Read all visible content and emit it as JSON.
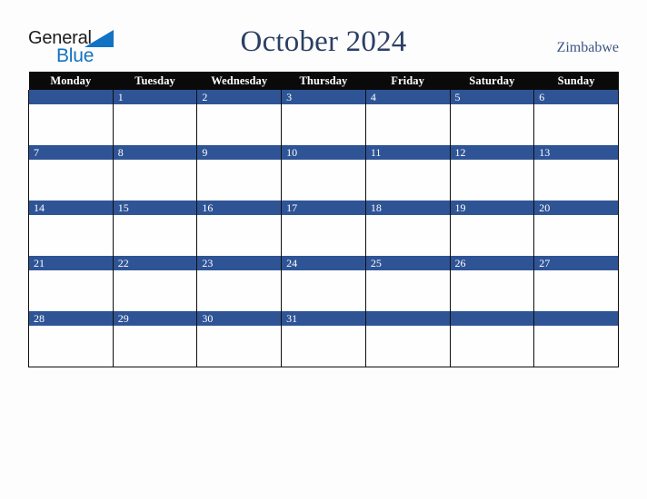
{
  "brand": {
    "word1": "General",
    "word2": "Blue",
    "triangle_icon": "triangle-icon",
    "word1_color": "#1c1c1c",
    "word2_color": "#1272c4",
    "triangle_color": "#1272c4"
  },
  "header": {
    "title": "October 2024",
    "country": "Zimbabwe",
    "title_color": "#2b3f64",
    "country_color": "#3c5580"
  },
  "calendar": {
    "weekday_headers": [
      "Monday",
      "Tuesday",
      "Wednesday",
      "Thursday",
      "Friday",
      "Saturday",
      "Sunday"
    ],
    "header_bg": "#0a0a0a",
    "header_text_color": "#ffffff",
    "daynum_bar_color": "#2f5496",
    "daynum_text_color": "#ffffff",
    "cell_bg": "#fefefe",
    "border_color": "#0e0e0e",
    "weeks": [
      [
        "",
        "1",
        "2",
        "3",
        "4",
        "5",
        "6"
      ],
      [
        "7",
        "8",
        "9",
        "10",
        "11",
        "12",
        "13"
      ],
      [
        "14",
        "15",
        "16",
        "17",
        "18",
        "19",
        "20"
      ],
      [
        "21",
        "22",
        "23",
        "24",
        "25",
        "26",
        "27"
      ],
      [
        "28",
        "29",
        "30",
        "31",
        "",
        "",
        ""
      ]
    ]
  },
  "page": {
    "background": "#fdfdfd"
  }
}
